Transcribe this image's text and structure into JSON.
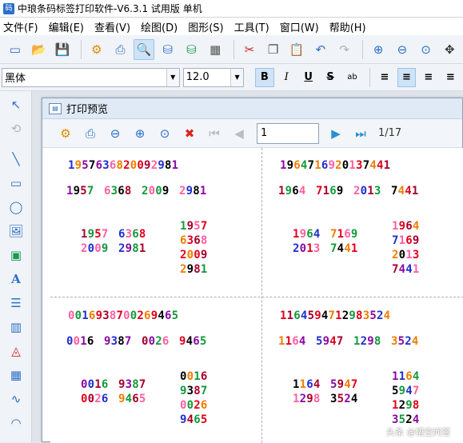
{
  "window": {
    "title": "中琅条码标签打印软件-V6.3.1 试用版 单机"
  },
  "menu": [
    "文件(F)",
    "编辑(E)",
    "查看(V)",
    "绘图(D)",
    "图形(S)",
    "工具(T)",
    "窗口(W)",
    "帮助(H)"
  ],
  "toolbar": {
    "icons": [
      "new-icon",
      "open-icon",
      "save-icon",
      "settings-icon",
      "print-icon",
      "print-preview-icon",
      "database-icon",
      "database-link-icon",
      "grid-icon",
      "cut-icon",
      "copy-icon",
      "paste-icon",
      "undo-icon",
      "redo-icon",
      "zoom-in-icon",
      "zoom-out-icon",
      "zoom-fit-icon",
      "move-icon"
    ]
  },
  "format": {
    "font_name": "黑体",
    "font_size": "12.0",
    "bold": "B",
    "italic": "I",
    "underline": "U",
    "strike": "S",
    "kern": "ab"
  },
  "preview": {
    "title": "打印预览",
    "page_input": "1",
    "page_count": "1/17"
  },
  "colors": {
    "black": "#000000",
    "red": "#e0001b",
    "blue": "#1f2fd1",
    "green": "#129a3a",
    "purple": "#8a0aa0",
    "orange": "#f07d00",
    "pink": "#ff5fa2",
    "darkred": "#a8002a"
  },
  "pages": [
    {
      "full": "19576368200929 81",
      "full_text": "1957636820092981",
      "groups": [
        "1957",
        "6368",
        "2009",
        "2981"
      ]
    },
    {
      "full_text": "1964716920137441",
      "groups": [
        "1964",
        "7169",
        "2013",
        "7441"
      ]
    },
    {
      "full_text": "0016938700269465",
      "groups": [
        "0016",
        "9387",
        "0026",
        "9465"
      ]
    },
    {
      "full_text": "1164594712983524",
      "groups": [
        "1164",
        "5947",
        "1298",
        "3524"
      ]
    }
  ],
  "watermark": "头条 @悟空问答"
}
